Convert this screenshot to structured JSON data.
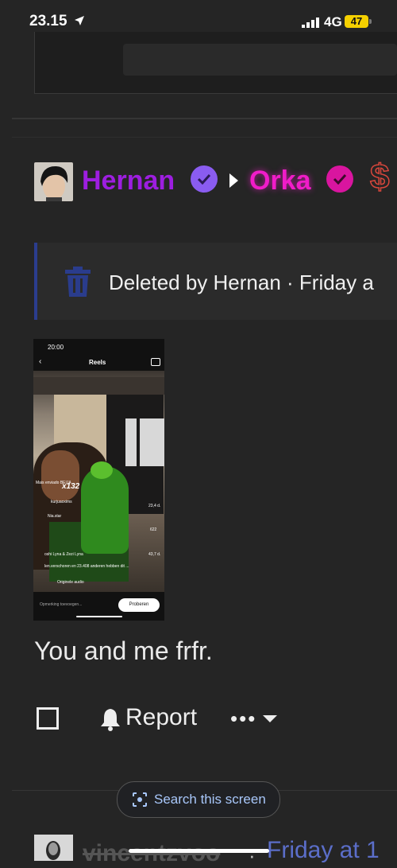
{
  "status": {
    "time": "23.15",
    "network": "4G",
    "battery": "47"
  },
  "post": {
    "author": "Hernan",
    "recipient": "Orka",
    "deleted_notice": "Deleted by Hernan · Friday a",
    "message": "You and me frfr.",
    "reel": {
      "time": "20:00",
      "title": "Reels",
      "likes_overlay": "x132",
      "user_line": "Mais enviado BEIJA",
      "handle": "kurjuaoxims",
      "second_handle": "Nia.star",
      "views_text": "len.verschoren en 23.408 anderen hebben dit ...",
      "audio": "Originele audio",
      "side_count_1": "23,4 d.",
      "side_count_2": "622",
      "side_count_3": "43,7 d.",
      "comment_placeholder": "Opmerking toevoegen...",
      "try_button": "Proberen",
      "music_credit": "oshi Lyna & Zezi Lyna"
    }
  },
  "actions": {
    "report": "Report",
    "more": "•••"
  },
  "search_pill": {
    "label": "Search this screen"
  },
  "next_post": {
    "author": "vincentzvoo",
    "separator": "·",
    "date": "Friday at 1"
  },
  "colors": {
    "author": "#9d1ee0",
    "recipient": "#f01cc8",
    "link": "#5b6ec9",
    "banner_accent": "#2b3d8e"
  }
}
